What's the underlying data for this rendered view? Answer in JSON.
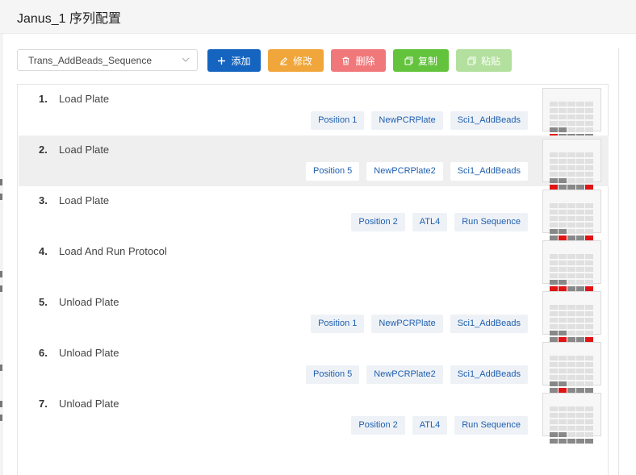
{
  "header": {
    "title": "Janus_1 序列配置"
  },
  "toolbar": {
    "sequence_select": "Trans_AddBeads_Sequence",
    "add_label": "添加",
    "edit_label": "修改",
    "delete_label": "删除",
    "copy_label": "复制",
    "paste_label": "粘贴"
  },
  "steps": [
    {
      "num": "1.",
      "name": "Load Plate",
      "tags": [
        "Position 1",
        "NewPCRPlate",
        "Sci1_AddBeads"
      ],
      "plate_red_wells": [
        "r6c1"
      ]
    },
    {
      "num": "2.",
      "name": "Load Plate",
      "tags": [
        "Position 5",
        "NewPCRPlate2",
        "Sci1_AddBeads"
      ],
      "plate_red_wells": [
        "r6c1",
        "r6c5"
      ]
    },
    {
      "num": "3.",
      "name": "Load Plate",
      "tags": [
        "Position 2",
        "ATL4",
        "Run Sequence"
      ],
      "plate_red_wells": [
        "r6c2",
        "r6c5"
      ]
    },
    {
      "num": "4.",
      "name": "Load And Run Protocol",
      "tags": [],
      "plate_red_wells": [
        "r6c1",
        "r6c2",
        "r6c5"
      ]
    },
    {
      "num": "5.",
      "name": "Unload Plate",
      "tags": [
        "Position 1",
        "NewPCRPlate",
        "Sci1_AddBeads"
      ],
      "plate_red_wells": [
        "r6c2",
        "r6c5"
      ]
    },
    {
      "num": "6.",
      "name": "Unload Plate",
      "tags": [
        "Position 5",
        "NewPCRPlate2",
        "Sci1_AddBeads"
      ],
      "plate_red_wells": [
        "r6c2"
      ]
    },
    {
      "num": "7.",
      "name": "Unload Plate",
      "tags": [
        "Position 2",
        "ATL4",
        "Run Sequence"
      ],
      "plate_red_wells": []
    }
  ],
  "colors": {
    "primary": "#1565c0",
    "warning": "#f0a63a",
    "danger": "#f0787a",
    "success": "#63c33c",
    "success_disabled": "#b3e09e",
    "tag_text": "#1f5fae",
    "plate_well_occupied": "#888888",
    "plate_well_red": "#e01414",
    "selected_row": "#efefef"
  },
  "icons": {
    "add": "plus-icon",
    "edit": "pencil-icon",
    "delete": "trash-icon",
    "copy": "copy-icon",
    "paste": "paste-icon",
    "select": "chevron-down-icon"
  }
}
